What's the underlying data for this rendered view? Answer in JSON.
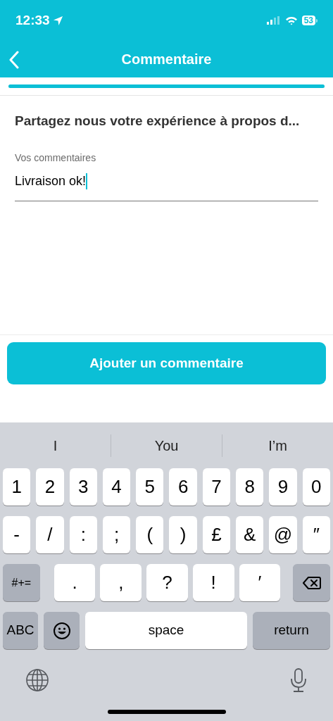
{
  "status_bar": {
    "time": "12:33",
    "battery": "53"
  },
  "nav": {
    "title": "Commentaire"
  },
  "progress": {
    "level": 1
  },
  "form": {
    "heading": "Partagez nous votre expérience à propos d...",
    "field": {
      "label": "Vos commentaires",
      "value": "Livraison ok!",
      "focused": true
    }
  },
  "submit_button": {
    "label": "Ajouter un commentaire"
  },
  "keyboard": {
    "suggestions": [
      "I",
      "You",
      "I’m"
    ],
    "key_rows": [
      {
        "keys": [
          {
            "kind": "char",
            "label": "1"
          },
          {
            "kind": "char",
            "label": "2"
          },
          {
            "kind": "char",
            "label": "3"
          },
          {
            "kind": "char",
            "label": "4"
          },
          {
            "kind": "char",
            "label": "5"
          },
          {
            "kind": "char",
            "label": "6"
          },
          {
            "kind": "char",
            "label": "7"
          },
          {
            "kind": "char",
            "label": "8"
          },
          {
            "kind": "char",
            "label": "9"
          },
          {
            "kind": "char",
            "label": "0"
          }
        ]
      },
      {
        "keys": [
          {
            "kind": "char",
            "label": "-"
          },
          {
            "kind": "char",
            "label": "/"
          },
          {
            "kind": "char",
            "label": ":"
          },
          {
            "kind": "char",
            "label": ";"
          },
          {
            "kind": "char",
            "label": "("
          },
          {
            "kind": "char",
            "label": ")"
          },
          {
            "kind": "char",
            "label": "£"
          },
          {
            "kind": "char",
            "label": "&"
          },
          {
            "kind": "char",
            "label": "@"
          },
          {
            "kind": "char",
            "label": "″"
          }
        ]
      },
      {
        "keys": [
          {
            "kind": "function",
            "label": "#+="
          },
          {
            "kind": "wide",
            "label": "."
          },
          {
            "kind": "wide",
            "label": ","
          },
          {
            "kind": "wide",
            "label": "?"
          },
          {
            "kind": "wide",
            "label": "!"
          },
          {
            "kind": "wide",
            "label": "′"
          },
          {
            "kind": "delete"
          }
        ]
      },
      {
        "keys": [
          {
            "kind": "mode",
            "label": "ABC"
          },
          {
            "kind": "emoji"
          },
          {
            "kind": "space",
            "label": "space"
          },
          {
            "kind": "return",
            "label": "return"
          }
        ]
      }
    ]
  }
}
